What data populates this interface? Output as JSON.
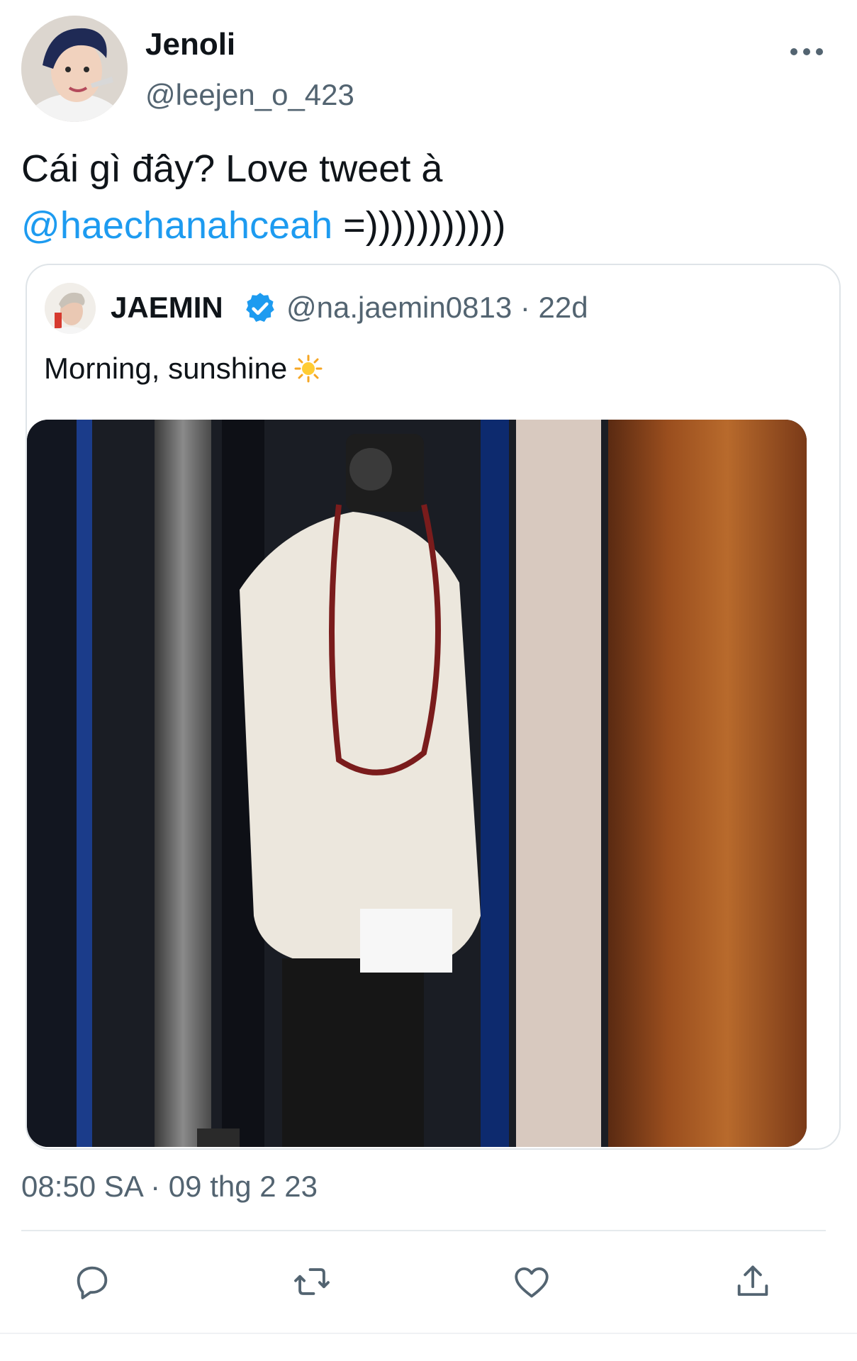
{
  "author": {
    "display_name": "Jenoli",
    "handle": "@leejen_o_423"
  },
  "tweet": {
    "text_line1": "Cái gì đây? Love tweet à",
    "mention": "@haechanahceah",
    "text_suffix": " =)))))))))))"
  },
  "quoted": {
    "display_name": "JAEMIN",
    "handle_time": "@na.jaemin0813 · 22d",
    "text": "Morning, sunshine",
    "emoji_icon": "sun-icon"
  },
  "meta": {
    "timestamp": "08:50 SA · 09 thg 2 23"
  },
  "actions": {
    "icons": [
      "reply-icon",
      "retweet-icon",
      "like-icon",
      "share-icon"
    ]
  },
  "colors": {
    "mention": "#1d9bf0",
    "verified": "#1d9bf0",
    "secondary_text": "#536471"
  }
}
